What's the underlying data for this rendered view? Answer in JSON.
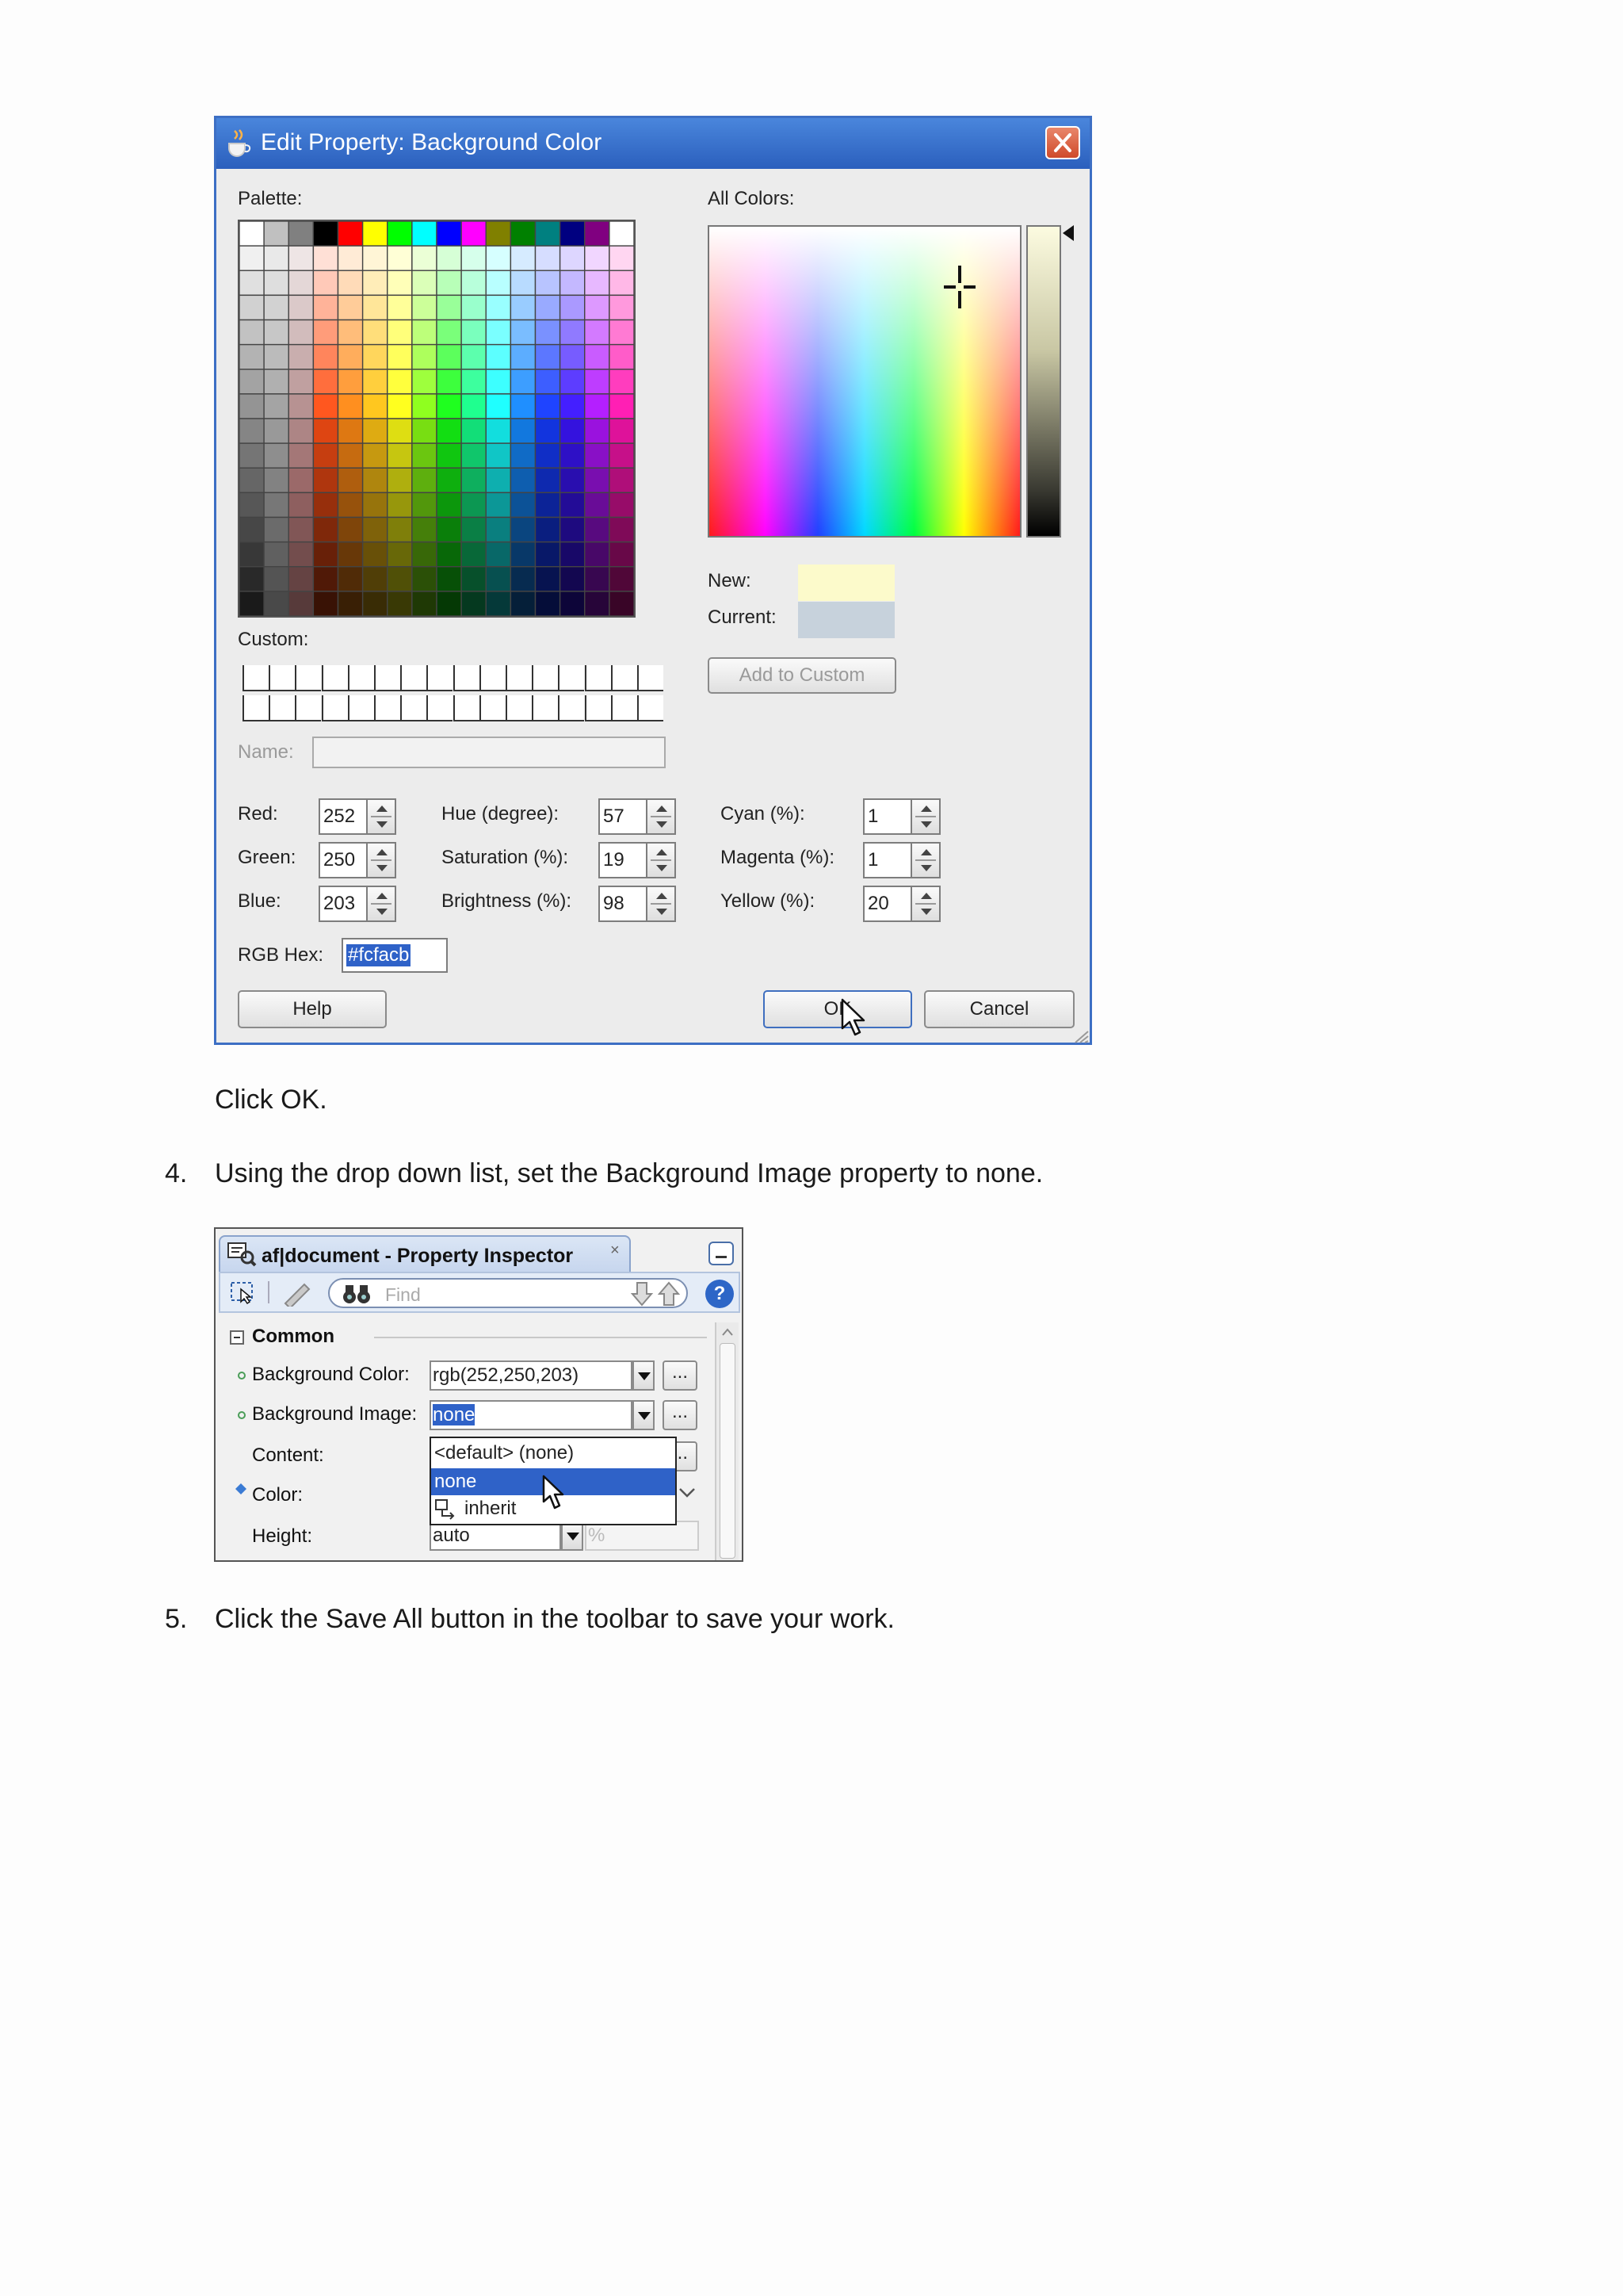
{
  "dialog": {
    "title": "Edit Property: Background Color",
    "palette_label": "Palette:",
    "all_colors_label": "All Colors:",
    "custom_label": "Custom:",
    "name_label": "Name:",
    "new_label": "New:",
    "current_label": "Current:",
    "new_color": "#fcfacb",
    "current_color": "#c7d2dc",
    "add_to_custom_label": "Add to Custom",
    "fields": {
      "red": {
        "label": "Red:",
        "value": "252"
      },
      "green": {
        "label": "Green:",
        "value": "250"
      },
      "blue": {
        "label": "Blue:",
        "value": "203"
      },
      "hue": {
        "label": "Hue (degree):",
        "value": "57"
      },
      "saturation": {
        "label": "Saturation (%):",
        "value": "19"
      },
      "brightness": {
        "label": "Brightness (%):",
        "value": "98"
      },
      "cyan": {
        "label": "Cyan (%):",
        "value": "1"
      },
      "magenta": {
        "label": "Magenta (%):",
        "value": "1"
      },
      "yellow": {
        "label": "Yellow (%):",
        "value": "20"
      }
    },
    "rgb_hex_label": "RGB Hex:",
    "rgb_hex_value": "#fcfacb",
    "help_label": "Help",
    "ok_label": "OK",
    "cancel_label": "Cancel"
  },
  "text": {
    "click_ok": "Click OK.",
    "step4_num": "4.",
    "step4": "Using the drop down list, set the Background Image property to none.",
    "step5_num": "5.",
    "step5": "Click the Save All button in the toolbar to save your work."
  },
  "inspector": {
    "title": "af|document - Property Inspector",
    "close_glyph": "×",
    "find_placeholder": "Find",
    "help_glyph": "?",
    "section": "Common",
    "background_color_label": "Background Color:",
    "background_color_value": "rgb(252,250,203)",
    "background_image_label": "Background Image:",
    "background_image_value": "none",
    "content_label": "Content:",
    "color_label": "Color:",
    "height_label": "Height:",
    "height_value": "auto",
    "height_unit": "%",
    "dots": "...",
    "dropdown_options": [
      "<default> (none)",
      "none",
      "inherit"
    ]
  }
}
